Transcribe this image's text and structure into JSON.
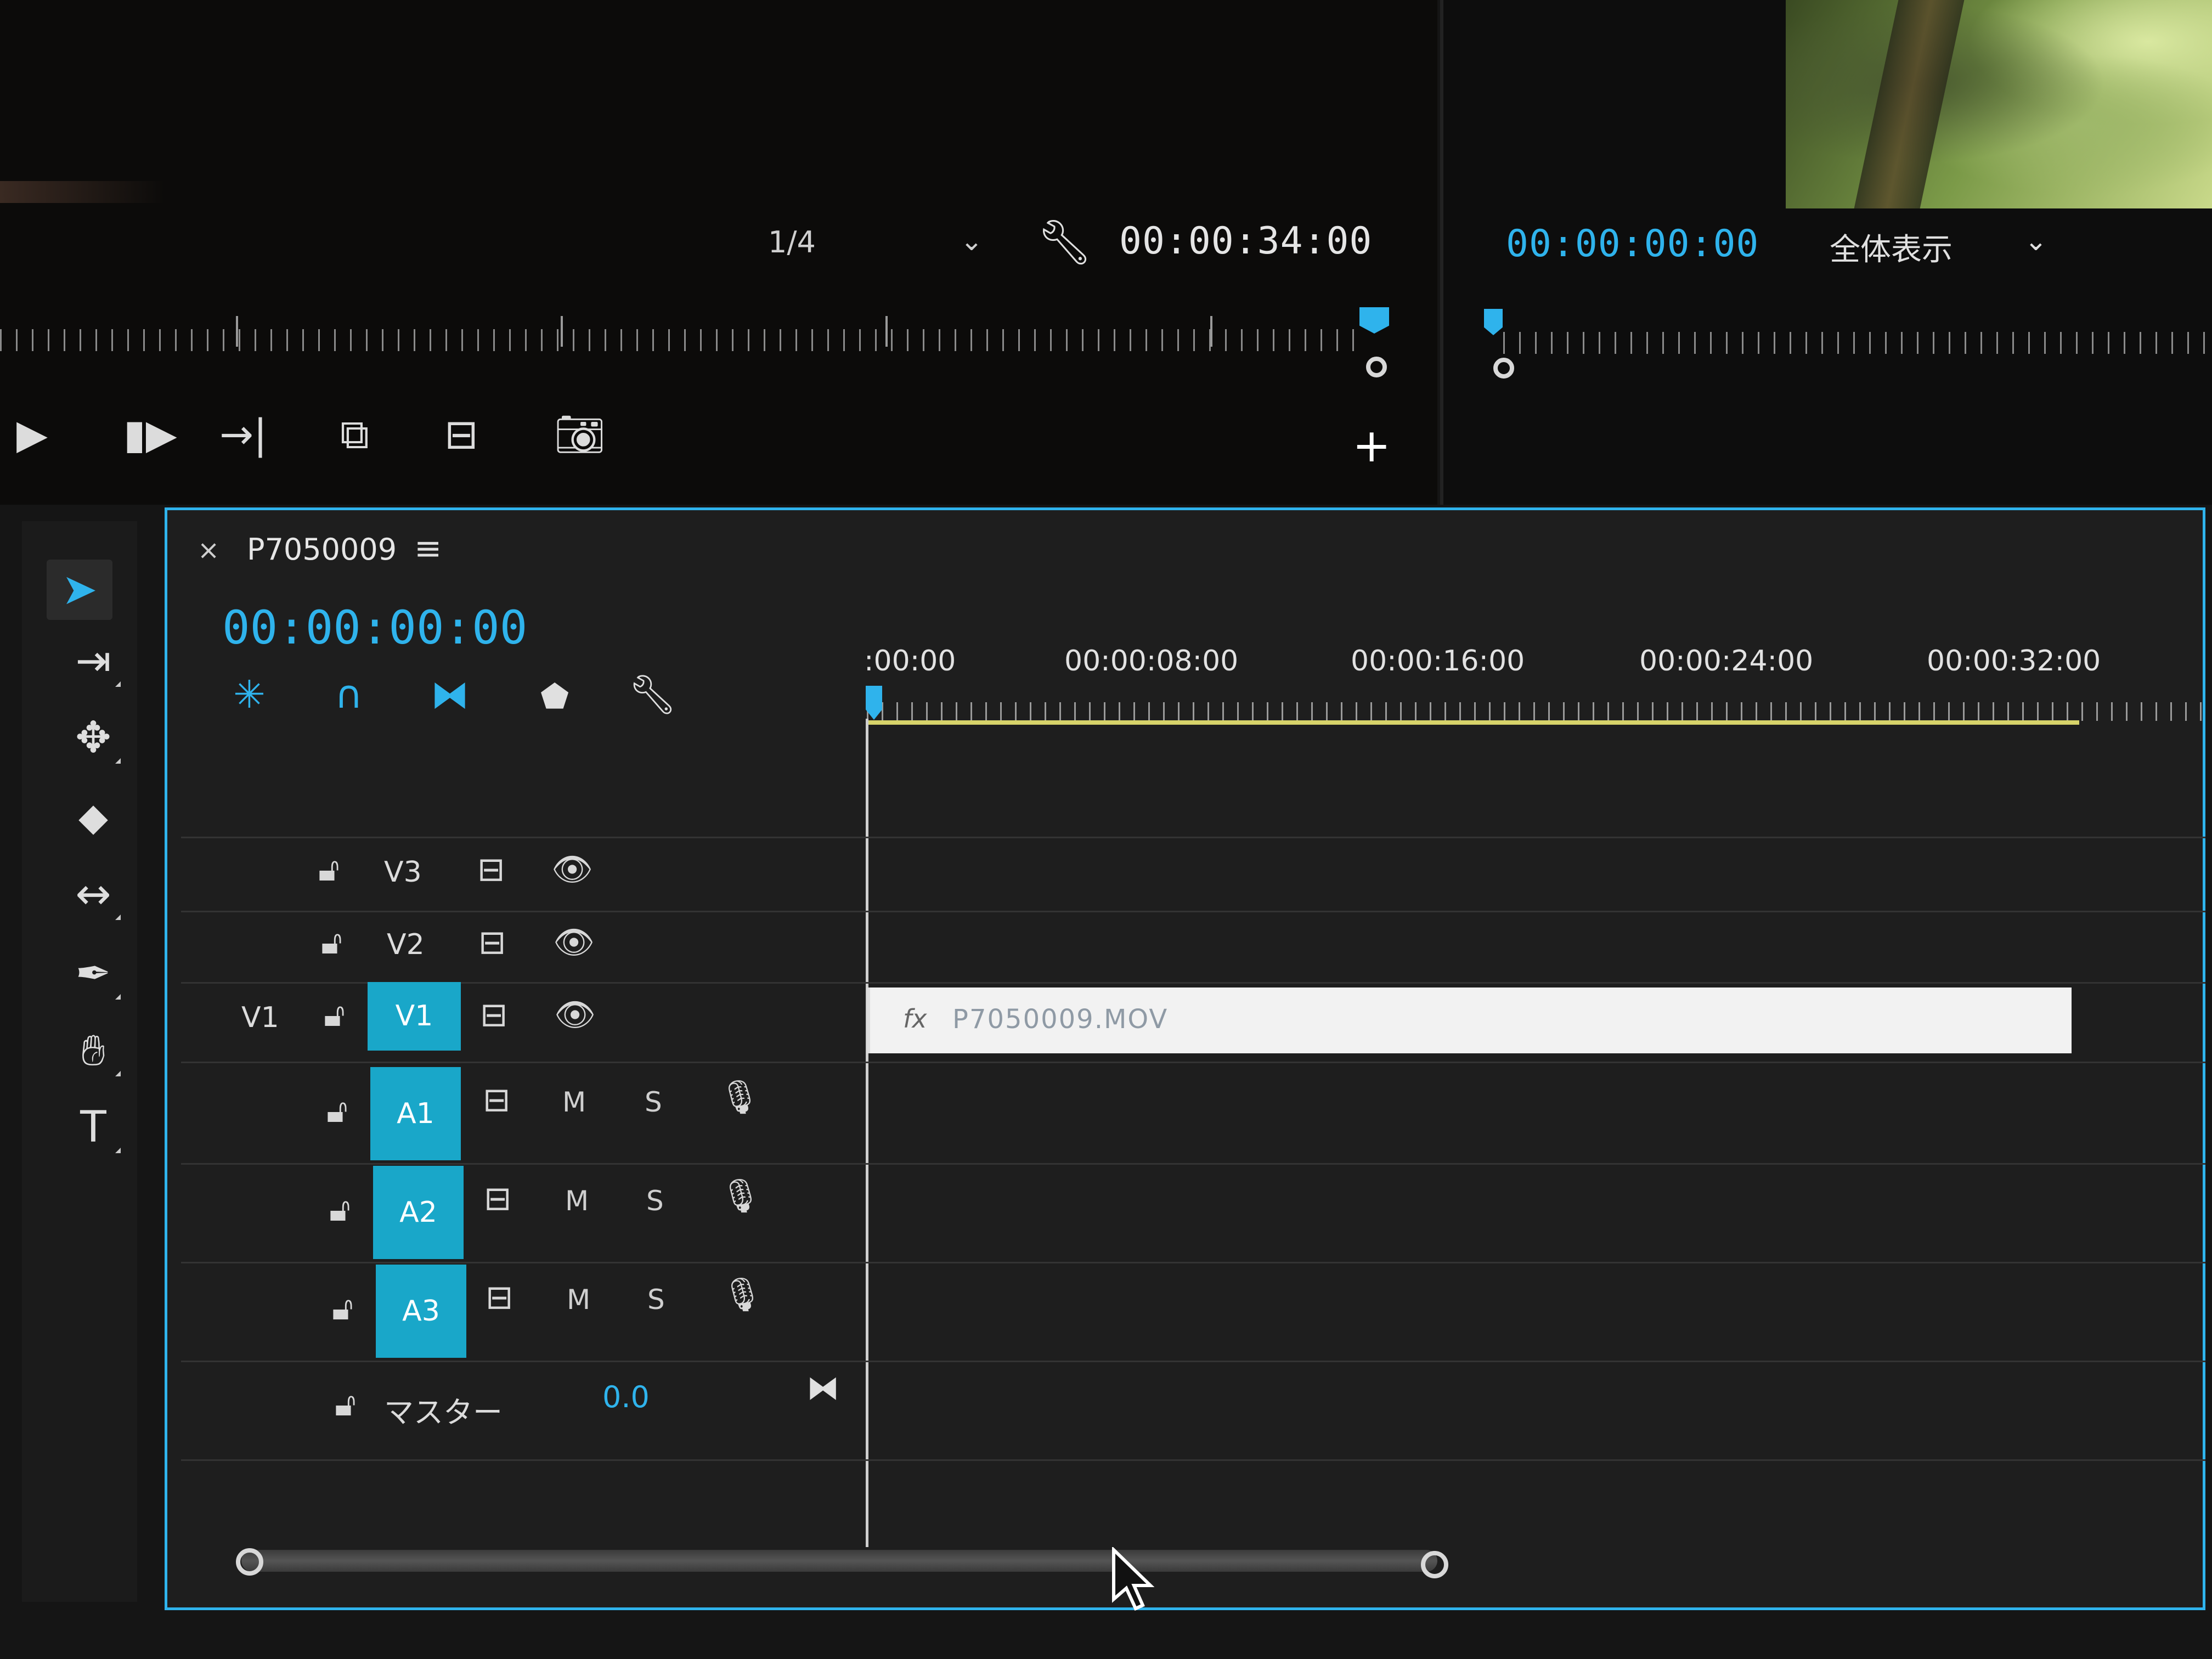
{
  "source_monitor": {
    "zoom_fraction": "1/4",
    "duration_timecode": "00:00:34:00"
  },
  "program_monitor": {
    "current_timecode": "00:00:00:00",
    "fit_label": "全体表示"
  },
  "timeline": {
    "sequence_name": "P7050009",
    "current_timecode": "00:00:00:00",
    "ruler_labels": [
      ":00:00",
      "00:00:08:00",
      "00:00:16:00",
      "00:00:24:00",
      "00:00:32:00"
    ],
    "video_tracks": [
      {
        "name": "V3"
      },
      {
        "name": "V2"
      },
      {
        "name": "V1",
        "source_patch": "V1"
      }
    ],
    "audio_tracks": [
      {
        "name": "A1",
        "mute": "M",
        "solo": "S"
      },
      {
        "name": "A2",
        "mute": "M",
        "solo": "S"
      },
      {
        "name": "A3",
        "mute": "M",
        "solo": "S"
      }
    ],
    "master": {
      "label": "マスター",
      "value": "0.0"
    },
    "clip": {
      "fx_label": "fx",
      "name": "P7050009.MOV"
    }
  },
  "colors": {
    "accent": "#2fb3ec",
    "track_target": "#19a7c9",
    "clip": "#f2f2f2"
  }
}
